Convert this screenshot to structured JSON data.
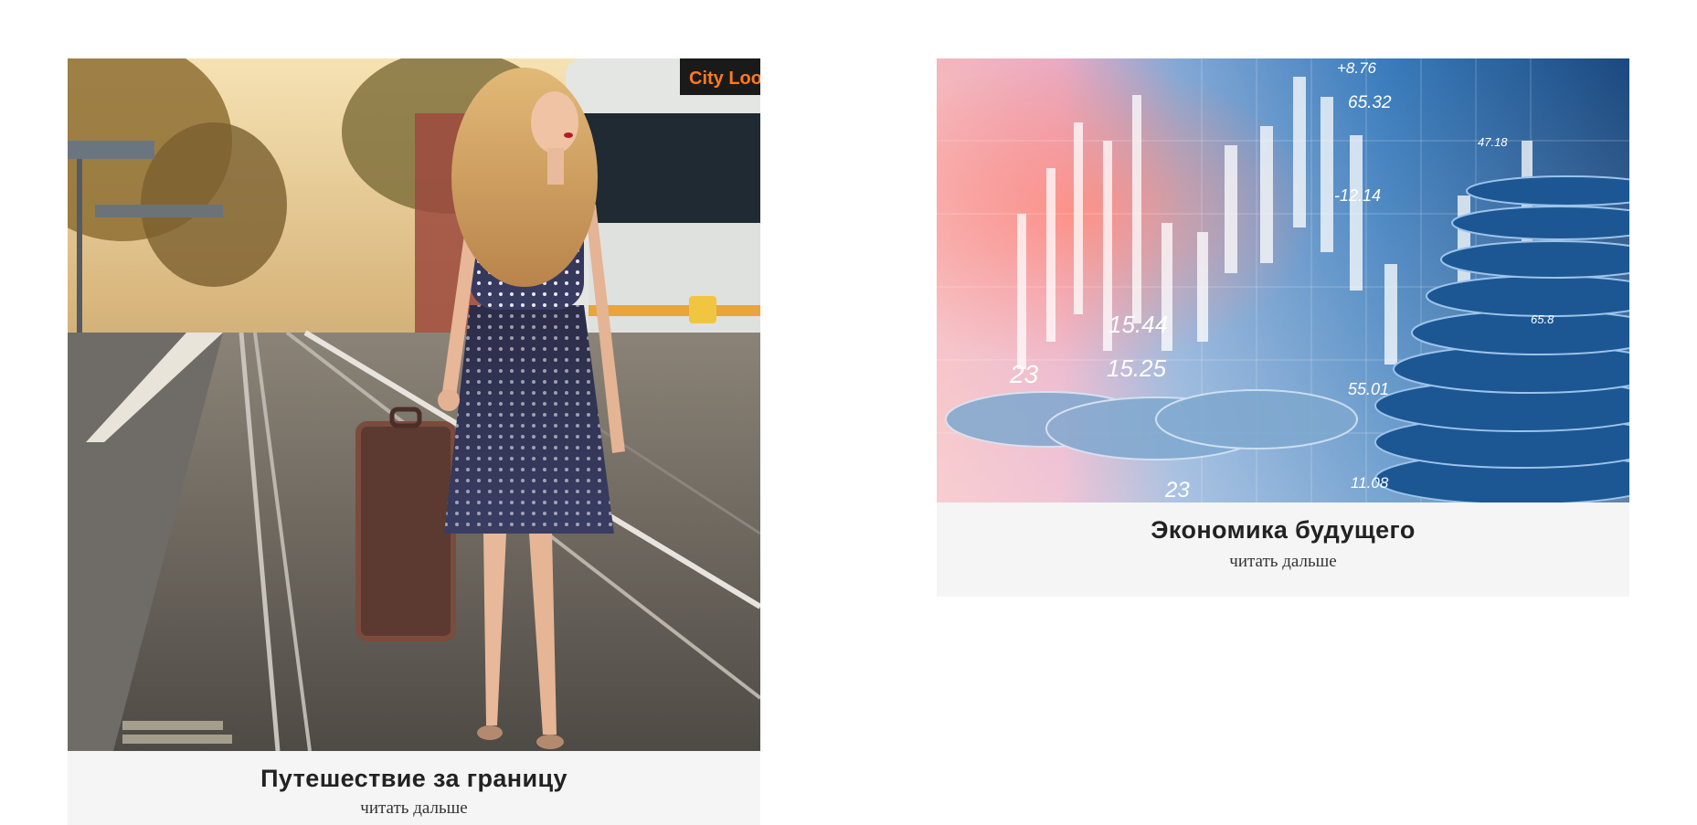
{
  "cards": [
    {
      "title": "Путешествие за границу",
      "link_label": "читать дальше",
      "image_subject": "woman-with-suitcase-on-tram-tracks",
      "display_text": "City Loop"
    },
    {
      "title": "Экономика будущего",
      "link_label": "читать дальше",
      "image_subject": "stock-chart-over-coins",
      "chart_numbers": [
        "+8.76",
        "65.32",
        "47.18",
        "-12.14",
        "15.44",
        "15.25",
        "23",
        "55.01",
        "11.08",
        "65.8",
        "23"
      ]
    }
  ],
  "colors": {
    "card_background": "#f5f5f5",
    "title_text": "#222222",
    "link_text": "#333333",
    "page_background": "#ffffff"
  }
}
